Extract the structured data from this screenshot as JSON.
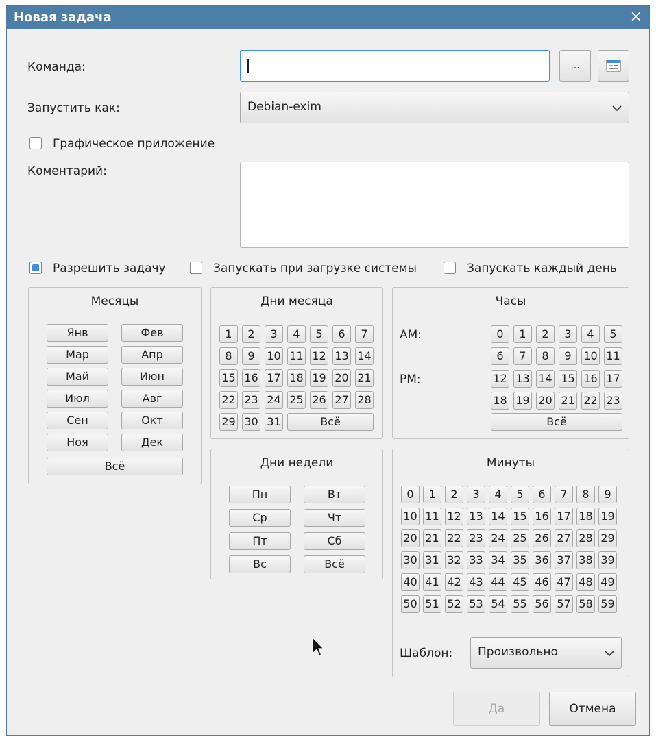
{
  "window": {
    "title": "Новая задача",
    "close_glyph": "×"
  },
  "form": {
    "command_label": "Команда:",
    "command_value": "",
    "browse_label": "...",
    "run_as_label": "Запустить как:",
    "run_as_value": "Debian-exim",
    "graphic_app_label": "Графическое приложение",
    "graphic_app_checked": false,
    "comment_label": "Коментарий:",
    "comment_value": ""
  },
  "options": {
    "enable_label": "Разрешить задачу",
    "enable_checked": true,
    "on_boot_label": "Запускать при загрузке системы",
    "on_boot_checked": false,
    "daily_label": "Запускать каждый день",
    "daily_checked": false
  },
  "months": {
    "title": "Месяцы",
    "items": [
      "Янв",
      "Фев",
      "Мар",
      "Апр",
      "Май",
      "Июн",
      "Июл",
      "Авг",
      "Сен",
      "Окт",
      "Ноя",
      "Дек"
    ],
    "all_label": "Всё"
  },
  "days_of_month": {
    "title": "Дни месяца",
    "items": [
      "1",
      "2",
      "3",
      "4",
      "5",
      "6",
      "7",
      "8",
      "9",
      "10",
      "11",
      "12",
      "13",
      "14",
      "15",
      "16",
      "17",
      "18",
      "19",
      "20",
      "21",
      "22",
      "23",
      "24",
      "25",
      "26",
      "27",
      "28",
      "29",
      "30",
      "31"
    ],
    "all_label": "Всё"
  },
  "hours": {
    "title": "Часы",
    "am_label": "AM:",
    "pm_label": "PM:",
    "am_items": [
      "0",
      "1",
      "2",
      "3",
      "4",
      "5",
      "6",
      "7",
      "8",
      "9",
      "10",
      "11"
    ],
    "pm_items": [
      "12",
      "13",
      "14",
      "15",
      "16",
      "17",
      "18",
      "19",
      "20",
      "21",
      "22",
      "23"
    ],
    "all_label": "Всё"
  },
  "weekdays": {
    "title": "Дни недели",
    "items": [
      "Пн",
      "Вт",
      "Ср",
      "Чт",
      "Пт",
      "Сб",
      "Вс",
      "Всё"
    ]
  },
  "minutes": {
    "title": "Минуты",
    "items": [
      "0",
      "1",
      "2",
      "3",
      "4",
      "5",
      "6",
      "7",
      "8",
      "9",
      "10",
      "11",
      "12",
      "13",
      "14",
      "15",
      "16",
      "17",
      "18",
      "19",
      "20",
      "21",
      "22",
      "23",
      "24",
      "25",
      "26",
      "27",
      "28",
      "29",
      "30",
      "31",
      "32",
      "33",
      "34",
      "35",
      "36",
      "37",
      "38",
      "39",
      "40",
      "41",
      "42",
      "43",
      "44",
      "45",
      "46",
      "47",
      "48",
      "49",
      "50",
      "51",
      "52",
      "53",
      "54",
      "55",
      "56",
      "57",
      "58",
      "59"
    ],
    "template_label": "Шаблон:",
    "template_value": "Произвольно"
  },
  "footer": {
    "ok_label": "Да",
    "cancel_label": "Отмена"
  },
  "icons": {
    "dropdown": "chevron-down-icon",
    "command_picker": "app-list-icon",
    "pointer": "mouse-pointer-icon"
  },
  "colors": {
    "titlebar": "#4d7ea8",
    "accent": "#3d8ee0"
  }
}
